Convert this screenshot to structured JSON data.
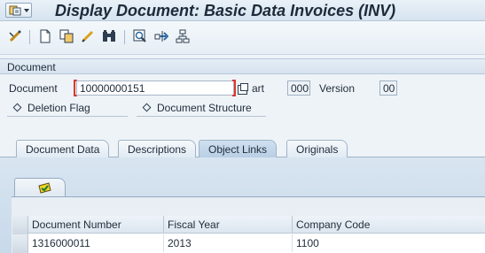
{
  "window": {
    "title": "Display Document: Basic Data Invoices (INV)"
  },
  "toolbar": {
    "icons": [
      "change-display-icon",
      "new-document-icon",
      "copy-icon",
      "edit-icon",
      "find-icon",
      "display-original-icon",
      "navigate-icon",
      "structure-icon"
    ]
  },
  "document_group": {
    "title": "Document",
    "document_label": "Document",
    "document_value": "10000000151",
    "part_label": "art",
    "part_value": "000",
    "version_label": "Version",
    "version_value": "00",
    "deletion_flag_label": "Deletion Flag",
    "document_structure_label": "Document Structure"
  },
  "tabs": [
    {
      "label": "Document Data",
      "active": false
    },
    {
      "label": "Descriptions",
      "active": false
    },
    {
      "label": "Object Links",
      "active": true
    },
    {
      "label": "Originals",
      "active": false
    }
  ],
  "object_links_table": {
    "columns": [
      "Document Number",
      "Fiscal Year",
      "Company Code"
    ],
    "rows": [
      [
        "1316000011",
        "2013",
        "1100"
      ]
    ]
  },
  "colors": {
    "accent_red": "#d93a2b",
    "title_text": "#1c2a3a",
    "panel_blue": "#c8d9ea"
  }
}
